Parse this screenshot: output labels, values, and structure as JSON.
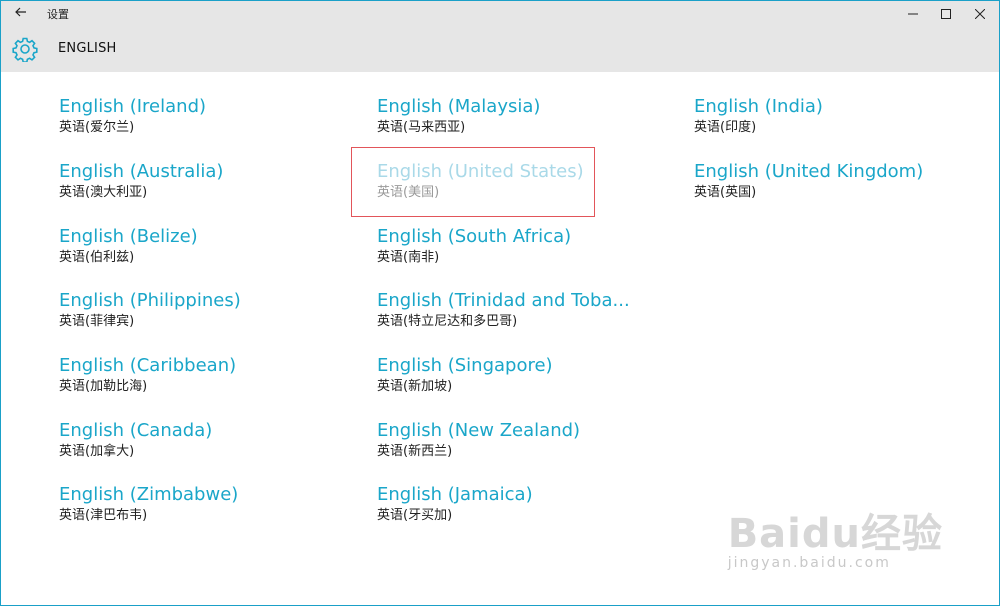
{
  "window": {
    "title": "设置",
    "back_icon": "back-arrow-icon",
    "controls": [
      "minimize-icon",
      "maximize-icon",
      "close-icon"
    ]
  },
  "header": {
    "icon": "gear-icon",
    "title": "ENGLISH"
  },
  "columns": [
    [
      {
        "en": "English (Ireland)",
        "zh": "英语(爱尔兰)"
      },
      {
        "en": "English (Australia)",
        "zh": "英语(澳大利亚)"
      },
      {
        "en": "English (Belize)",
        "zh": "英语(伯利兹)"
      },
      {
        "en": "English (Philippines)",
        "zh": "英语(菲律宾)"
      },
      {
        "en": "English (Caribbean)",
        "zh": "英语(加勒比海)"
      },
      {
        "en": "English (Canada)",
        "zh": "英语(加拿大)"
      },
      {
        "en": "English (Zimbabwe)",
        "zh": "英语(津巴布韦)"
      }
    ],
    [
      {
        "en": "English (Malaysia)",
        "zh": "英语(马来西亚)"
      },
      {
        "en": "English (United States)",
        "zh": "英语(美国)",
        "disabled": true
      },
      {
        "en": "English (South Africa)",
        "zh": "英语(南非)"
      },
      {
        "en": "English (Trinidad and Toba...",
        "zh": "英语(特立尼达和多巴哥)"
      },
      {
        "en": "English (Singapore)",
        "zh": "英语(新加坡)"
      },
      {
        "en": "English (New Zealand)",
        "zh": "英语(新西兰)"
      },
      {
        "en": "English (Jamaica)",
        "zh": "英语(牙买加)"
      }
    ],
    [
      {
        "en": "English (India)",
        "zh": "英语(印度)"
      },
      {
        "en": "English (United Kingdom)",
        "zh": "英语(英国)"
      }
    ]
  ],
  "watermark": {
    "main": "Baidu经验",
    "sub": "jingyan.baidu.com"
  },
  "colors": {
    "accent": "#1aa6c9",
    "highlight_border": "#e2555a",
    "header_bg": "#e6e6e6"
  }
}
